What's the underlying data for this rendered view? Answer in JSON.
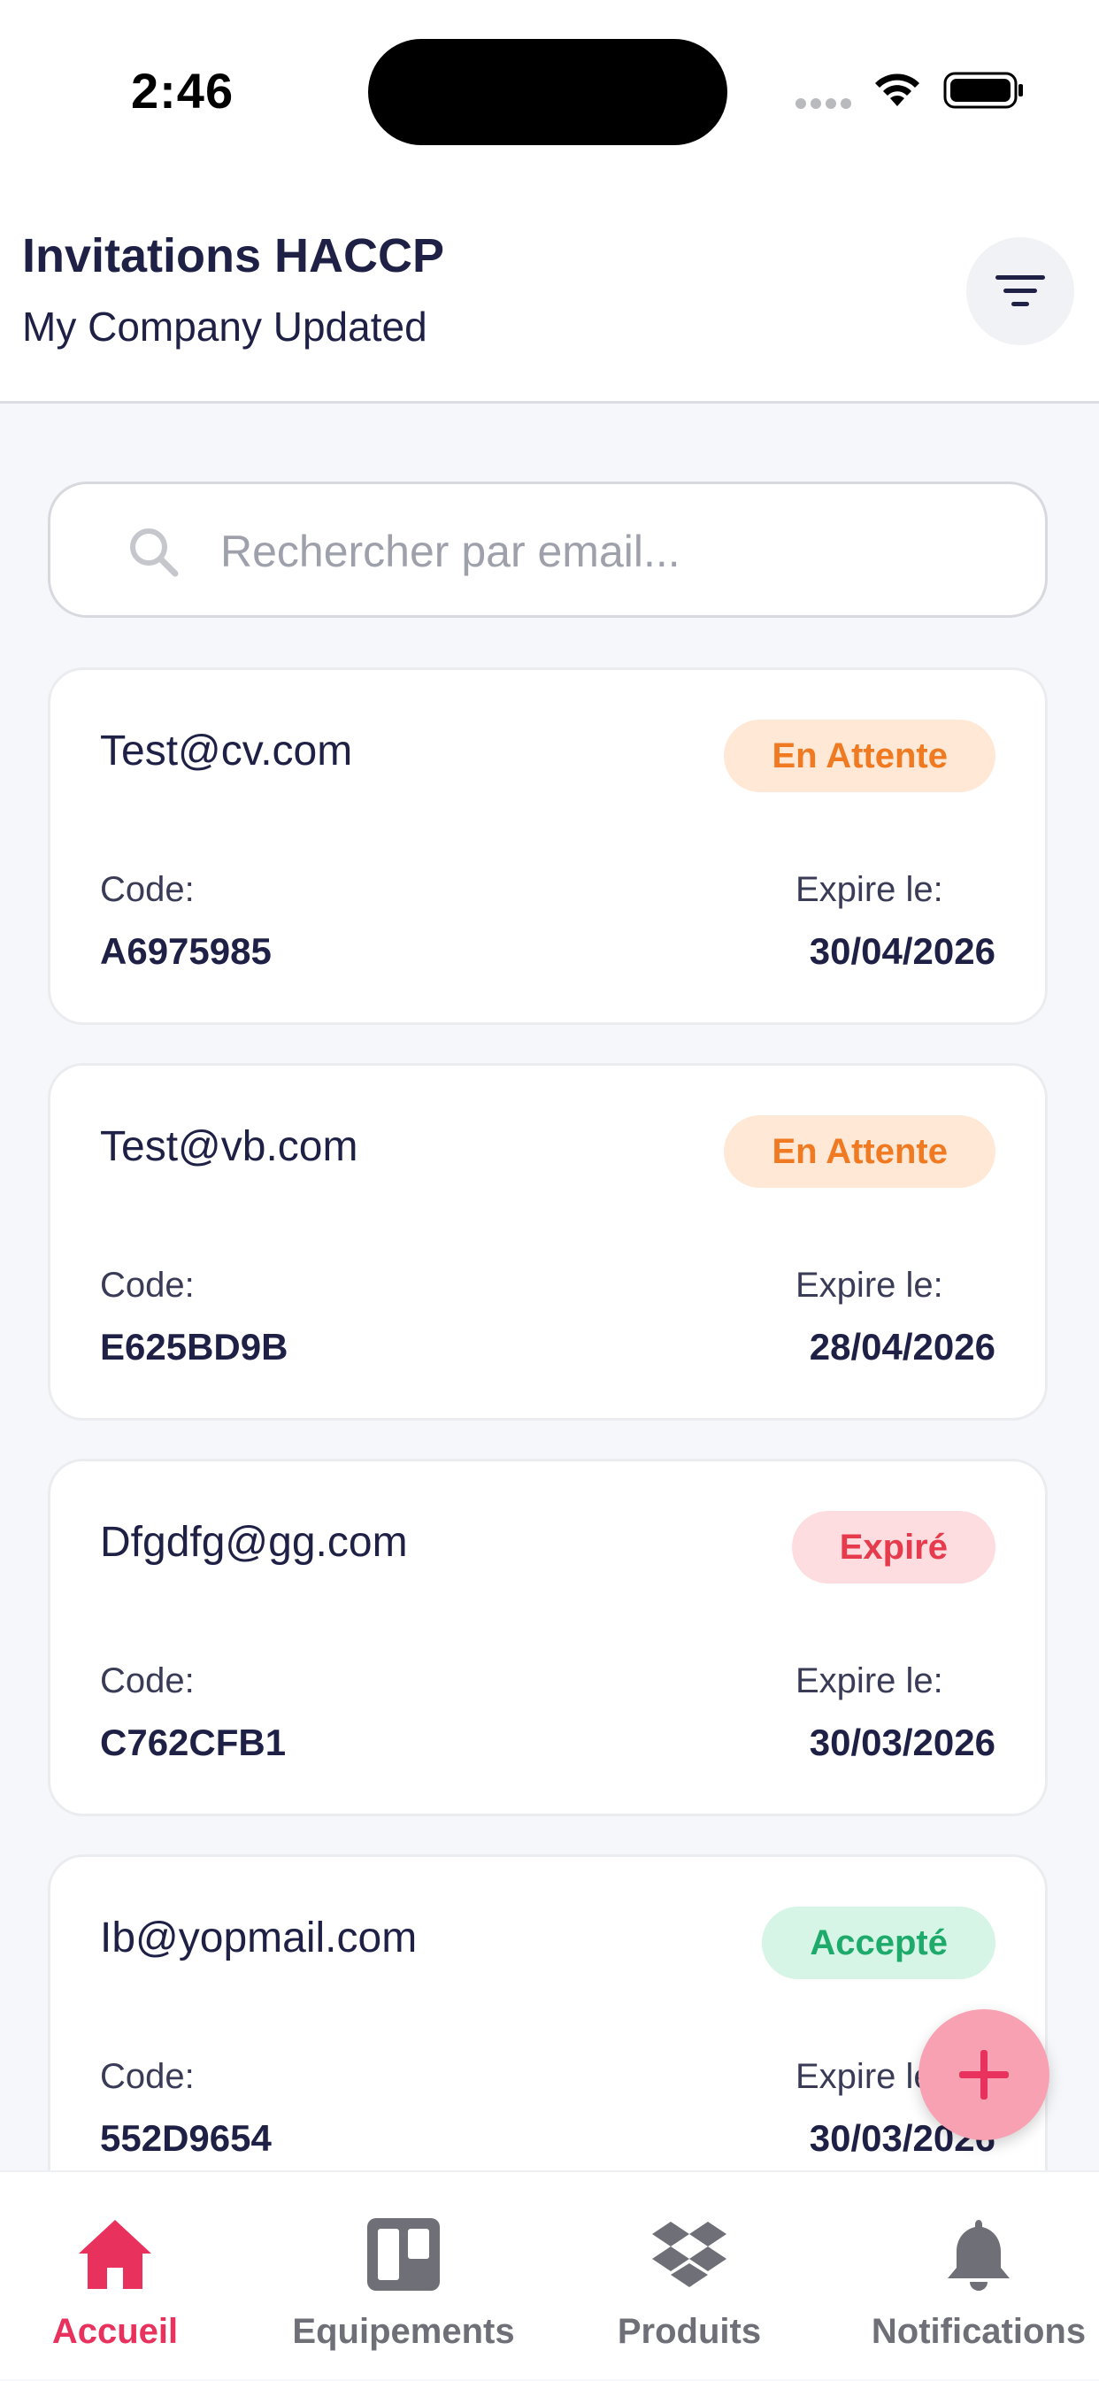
{
  "status_bar": {
    "time": "2:46"
  },
  "header": {
    "title": "Invitations HACCP",
    "subtitle": "My Company Updated",
    "filter_icon": "filter-icon"
  },
  "search": {
    "placeholder": "Rechercher par email...",
    "value": ""
  },
  "labels": {
    "code": "Code:",
    "expires": "Expire le:"
  },
  "invitations": [
    {
      "email": "Test@cv.com",
      "status": "En Attente",
      "status_type": "pending",
      "code": "A6975985",
      "expires": "30/04/2026"
    },
    {
      "email": "Test@vb.com",
      "status": "En Attente",
      "status_type": "pending",
      "code": "E625BD9B",
      "expires": "28/04/2026"
    },
    {
      "email": "Dfgdfg@gg.com",
      "status": "Expiré",
      "status_type": "expired",
      "code": "C762CFB1",
      "expires": "30/03/2026"
    },
    {
      "email": "Ib@yopmail.com",
      "status": "Accepté",
      "status_type": "accepted",
      "code": "552D9654",
      "expires": "30/03/2026"
    }
  ],
  "colors": {
    "accent": "#e8315c",
    "pending_bg": "#ffe8d5",
    "pending_text": "#f07a22",
    "expired_bg": "#fddde0",
    "expired_text": "#e53b4c",
    "accepted_bg": "#d6f5e7",
    "accepted_text": "#1eaa6b",
    "fab": "#f8a1b2"
  },
  "fab": {
    "icon": "plus-icon"
  },
  "bottom_nav": {
    "items": [
      {
        "label": "Accueil",
        "icon": "home-icon",
        "active": true
      },
      {
        "label": "Equipements",
        "icon": "board-icon",
        "active": false
      },
      {
        "label": "Produits",
        "icon": "dropbox-icon",
        "active": false
      },
      {
        "label": "Notifications",
        "icon": "bell-icon",
        "active": false
      }
    ]
  }
}
